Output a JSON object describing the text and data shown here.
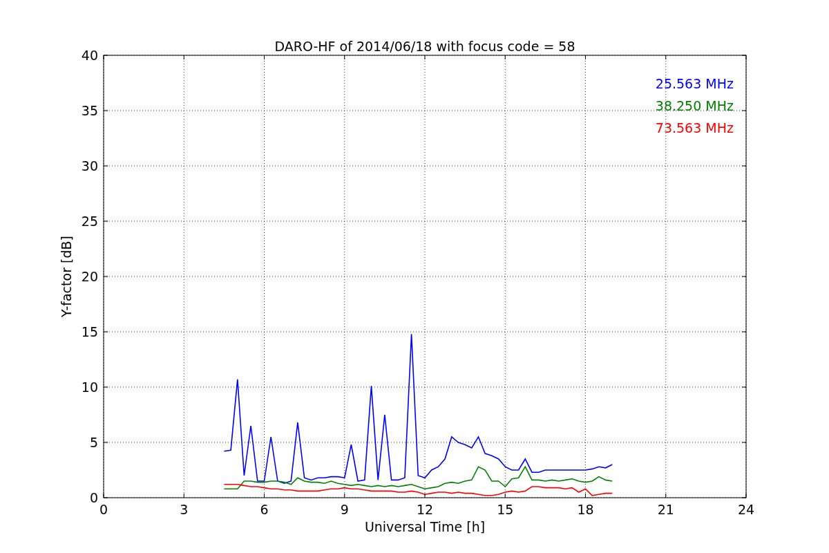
{
  "chart_data": {
    "type": "line",
    "title": "DARO-HF of 2014/06/18 with focus code = 58",
    "xlabel": "Universal Time [h]",
    "ylabel": "Y-factor [dB]",
    "x": [
      4.5,
      4.75,
      5,
      5.25,
      5.5,
      5.75,
      6,
      6.25,
      6.5,
      6.75,
      7,
      7.25,
      7.5,
      7.75,
      8,
      8.25,
      8.5,
      8.75,
      9,
      9.25,
      9.5,
      9.75,
      10,
      10.25,
      10.5,
      10.75,
      11,
      11.25,
      11.5,
      11.75,
      12,
      12.25,
      12.5,
      12.75,
      13,
      13.25,
      13.5,
      13.75,
      14,
      14.25,
      14.5,
      14.75,
      15,
      15.25,
      15.5,
      15.75,
      16,
      16.25,
      16.5,
      16.75,
      17,
      17.25,
      17.5,
      17.75,
      18,
      18.25,
      18.5,
      18.75,
      19
    ],
    "series": [
      {
        "name": "25.563 MHz",
        "color": "#0000ff",
        "values": [
          4.2,
          4.3,
          10.7,
          2.0,
          6.5,
          1.5,
          1.5,
          5.5,
          1.5,
          1.3,
          1.5,
          6.8,
          1.8,
          1.6,
          1.8,
          1.8,
          1.9,
          1.9,
          1.8,
          4.8,
          1.5,
          1.6,
          10.1,
          1.6,
          7.5,
          1.6,
          1.6,
          1.8,
          14.8,
          2.0,
          1.8,
          2.5,
          2.8,
          3.5,
          5.5,
          5.0,
          4.8,
          4.5,
          5.5,
          4.0,
          3.8,
          3.5,
          2.8,
          2.5,
          2.5,
          3.5,
          2.3,
          2.3,
          2.5,
          2.5,
          2.5,
          2.5,
          2.5,
          2.5,
          2.5,
          2.6,
          2.8,
          2.7,
          3.0
        ]
      },
      {
        "name": "38.250 MHz",
        "color": "#008000",
        "values": [
          0.8,
          0.8,
          0.8,
          1.5,
          1.5,
          1.4,
          1.4,
          1.5,
          1.5,
          1.4,
          1.2,
          1.8,
          1.5,
          1.4,
          1.4,
          1.3,
          1.5,
          1.3,
          1.2,
          1.1,
          1.2,
          1.1,
          1.0,
          1.1,
          1.0,
          1.1,
          1.0,
          1.1,
          1.2,
          1.0,
          0.8,
          0.9,
          1.0,
          1.3,
          1.4,
          1.3,
          1.5,
          1.6,
          2.8,
          2.5,
          1.5,
          1.5,
          1.0,
          1.7,
          1.8,
          2.8,
          1.6,
          1.6,
          1.5,
          1.6,
          1.5,
          1.6,
          1.7,
          1.5,
          1.4,
          1.5,
          1.9,
          1.6,
          1.5
        ]
      },
      {
        "name": "73.563 MHz",
        "color": "#ff0000",
        "values": [
          1.2,
          1.2,
          1.2,
          1.1,
          1.0,
          1.0,
          0.9,
          0.8,
          0.8,
          0.7,
          0.7,
          0.6,
          0.6,
          0.6,
          0.6,
          0.7,
          0.8,
          0.8,
          0.9,
          0.8,
          0.8,
          0.7,
          0.6,
          0.6,
          0.6,
          0.6,
          0.5,
          0.5,
          0.6,
          0.5,
          0.3,
          0.4,
          0.5,
          0.5,
          0.4,
          0.5,
          0.4,
          0.4,
          0.3,
          0.2,
          0.2,
          0.3,
          0.5,
          0.6,
          0.5,
          0.6,
          1.0,
          1.0,
          0.9,
          0.9,
          0.9,
          0.8,
          0.9,
          0.5,
          0.8,
          0.2,
          0.3,
          0.4,
          0.4
        ]
      }
    ],
    "xlim": [
      0,
      24
    ],
    "ylim": [
      0,
      40
    ],
    "xticks": [
      0,
      3,
      6,
      9,
      12,
      15,
      18,
      21,
      24
    ],
    "yticks": [
      0,
      5,
      10,
      15,
      20,
      25,
      30,
      35,
      40
    ],
    "grid": true
  }
}
